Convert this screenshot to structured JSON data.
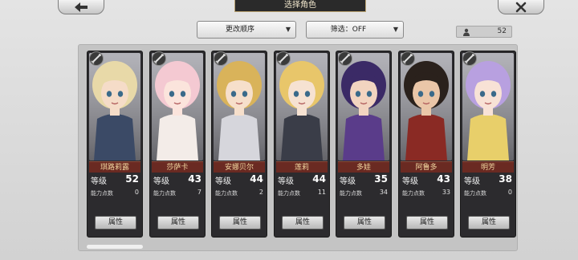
{
  "header": {
    "title": "选择角色",
    "back_icon": "back-arrow-icon",
    "close_icon": "close-x-icon"
  },
  "toolbar": {
    "sort_label": "更改顺序",
    "filter_label": "筛选：OFF",
    "count": "52"
  },
  "characters": [
    {
      "name": "琪路莉露",
      "level_label": "等级",
      "level": "52",
      "points_label": "能力点数",
      "points": "0",
      "button": "属性",
      "hair": "#e8d9a8",
      "outfit": "#3b4a66",
      "skin": "#f5dcc8"
    },
    {
      "name": "莎萨卡",
      "level_label": "等级",
      "level": "43",
      "points_label": "能力点数",
      "points": "7",
      "button": "属性",
      "hair": "#f4c9d2",
      "outfit": "#f3ece8",
      "skin": "#fbe4dc"
    },
    {
      "name": "安娜贝尔",
      "level_label": "等级",
      "level": "44",
      "points_label": "能力点数",
      "points": "2",
      "button": "属性",
      "hair": "#d9b35a",
      "outfit": "#d6d6dc",
      "skin": "#f6dfcb"
    },
    {
      "name": "莲莉",
      "level_label": "等级",
      "level": "44",
      "points_label": "能力点数",
      "points": "11",
      "button": "属性",
      "hair": "#e8c66a",
      "outfit": "#3a3d48",
      "skin": "#f6e2d2"
    },
    {
      "name": "多娃",
      "level_label": "等级",
      "level": "35",
      "points_label": "能力点数",
      "points": "34",
      "button": "属性",
      "hair": "#3b2a66",
      "outfit": "#5a3c8a",
      "skin": "#f2d4c0"
    },
    {
      "name": "阿鲁多",
      "level_label": "等级",
      "level": "43",
      "points_label": "能力点数",
      "points": "33",
      "button": "属性",
      "hair": "#2a211c",
      "outfit": "#8a2a24",
      "skin": "#eac6a8"
    },
    {
      "name": "明芳",
      "level_label": "等级",
      "level": "38",
      "points_label": "能力点数",
      "points": "0",
      "button": "属性",
      "hair": "#b8a0e0",
      "outfit": "#e8cf6a",
      "skin": "#f8e2d6"
    }
  ]
}
